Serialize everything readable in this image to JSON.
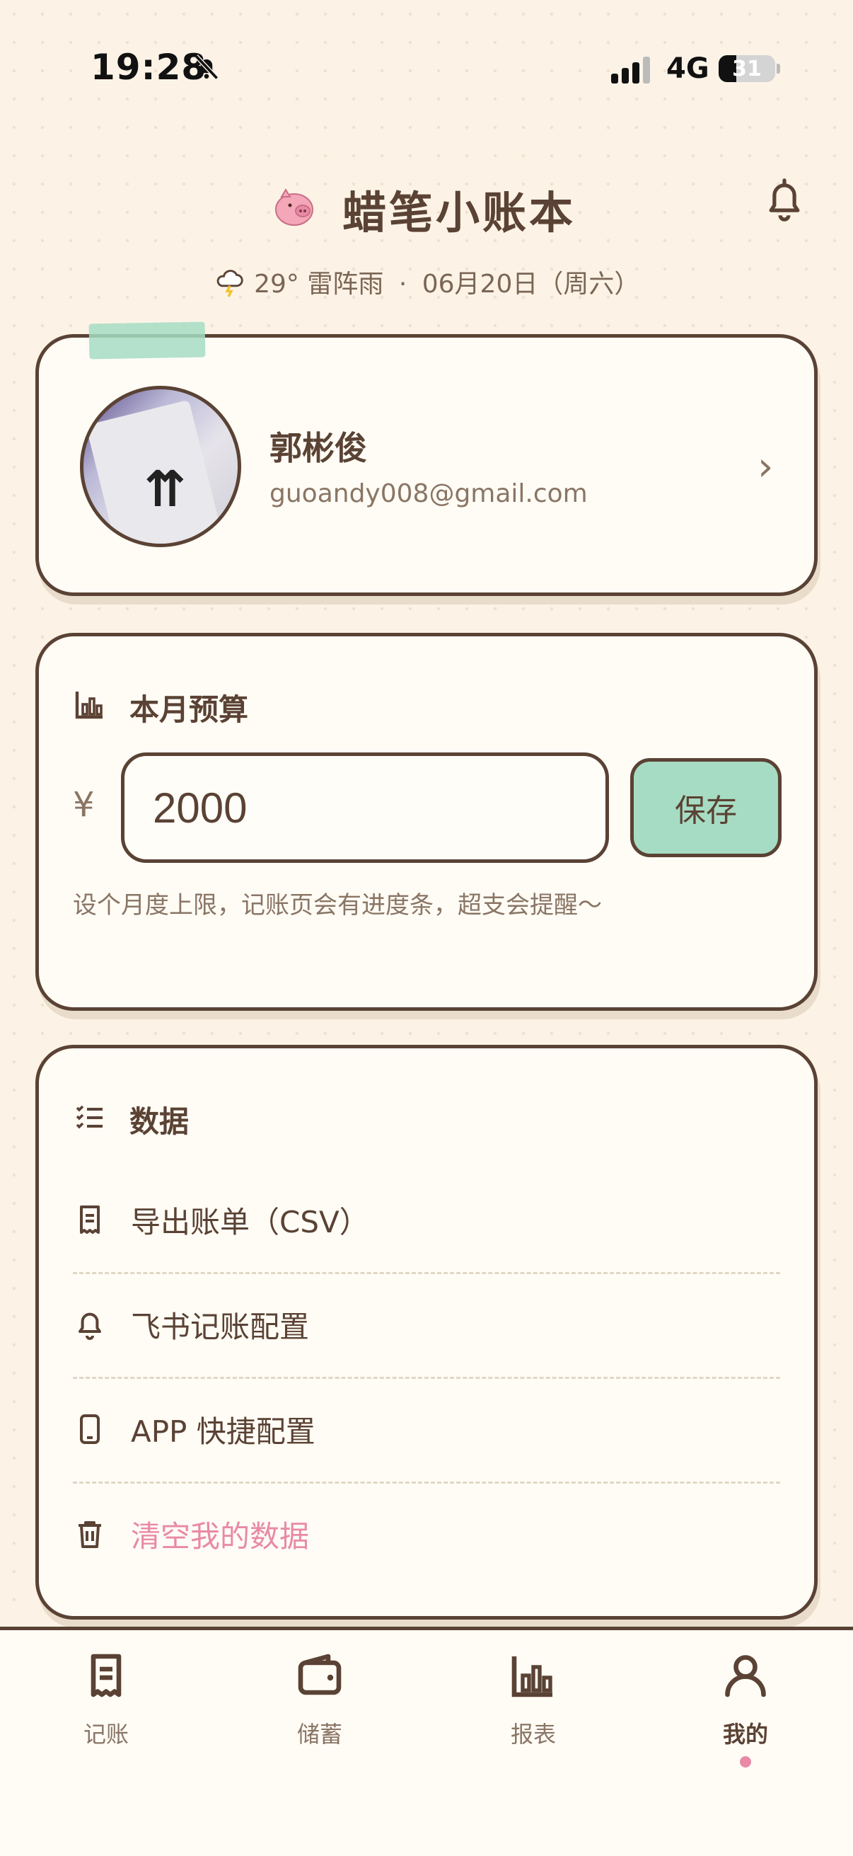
{
  "status_bar": {
    "time": "19:28",
    "network": "4G",
    "battery": "31"
  },
  "header": {
    "title": "蜡笔小账本",
    "temperature": "29°",
    "weather": "雷阵雨",
    "separator": "·",
    "date": "06月20日（周六）"
  },
  "profile": {
    "name": "郭彬俊",
    "email": "guoandy008@gmail.com",
    "chevron": "›"
  },
  "budget": {
    "title": "本月预算",
    "currency": "¥",
    "value": "2000",
    "save_label": "保存",
    "hint": "设个月度上限，记账页会有进度条，超支会提醒～"
  },
  "data_section": {
    "title": "数据",
    "items": [
      {
        "label": "导出账单（CSV）",
        "icon": "receipt-icon"
      },
      {
        "label": "飞书记账配置",
        "icon": "bell-icon"
      },
      {
        "label": "APP 快捷配置",
        "icon": "phone-icon"
      },
      {
        "label": "清空我的数据",
        "icon": "trash-icon"
      }
    ]
  },
  "tabbar": {
    "tabs": [
      {
        "label": "记账",
        "icon": "receipt-icon"
      },
      {
        "label": "储蓄",
        "icon": "wallet-icon"
      },
      {
        "label": "报表",
        "icon": "bar-chart-icon"
      },
      {
        "label": "我的",
        "icon": "user-icon"
      }
    ],
    "active_index": 3
  },
  "colors": {
    "background": "#fcf3e6",
    "ink": "#5a4234",
    "accent_green": "#a6dcc3",
    "danger_pink": "#e88aa6"
  }
}
